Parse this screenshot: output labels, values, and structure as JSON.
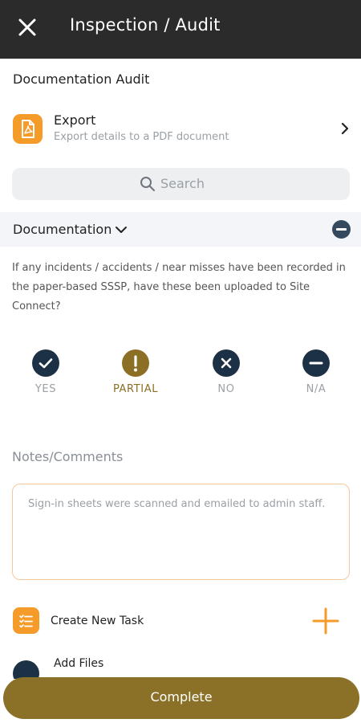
{
  "header": {
    "title": "Inspection / Audit",
    "close_icon": "close-icon"
  },
  "audit": {
    "name": "Documentation Audit"
  },
  "export": {
    "title": "Export",
    "subtitle": "Export details to a PDF document",
    "icon": "pdf-file-icon",
    "icon_color": "#f59b2a"
  },
  "search": {
    "placeholder": "Search"
  },
  "section": {
    "title": "Documentation"
  },
  "question": {
    "text": "If any incidents / accidents / near misses have been recorded in the paper-based SSSP, have these been uploaded to Site Connect?"
  },
  "options": [
    {
      "label": "YES",
      "icon": "check-icon",
      "selected": false
    },
    {
      "label": "PARTIAL",
      "icon": "exclamation-icon",
      "selected": true
    },
    {
      "label": "NO",
      "icon": "x-icon",
      "selected": false
    },
    {
      "label": "N/A",
      "icon": "minus-icon",
      "selected": false
    }
  ],
  "notes": {
    "label": "Notes/Comments",
    "placeholder": "Sign-in sheets were scanned and emailed to admin staff."
  },
  "actions": {
    "create_task": "Create New Task",
    "add_files": "Add Files"
  },
  "footer": {
    "complete": "Complete"
  },
  "colors": {
    "accent": "#f59b2a",
    "navy": "#1d3146",
    "gold": "#8b7128",
    "header": "#2b2b2b"
  }
}
